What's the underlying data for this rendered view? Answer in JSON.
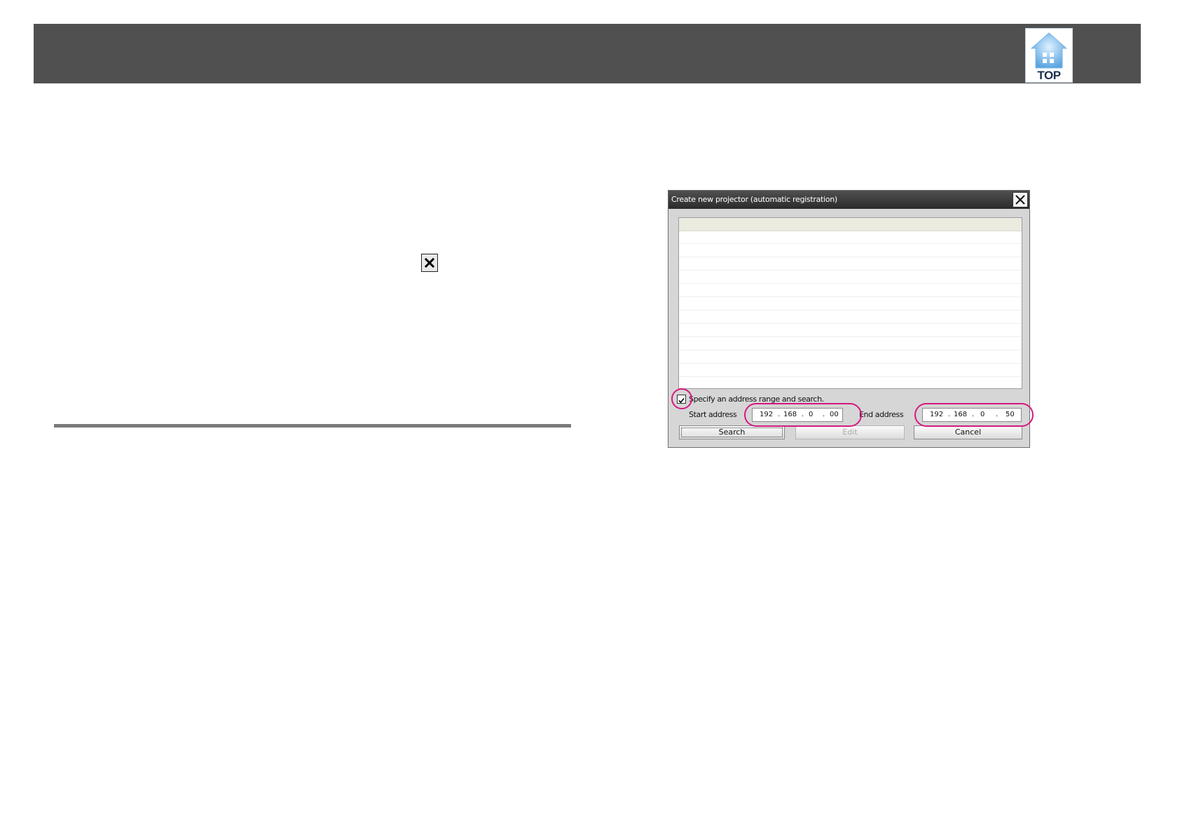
{
  "header": {
    "logo_label": "TOP"
  },
  "dialog": {
    "title": "Create new projector (automatic registration)",
    "specify_range_label": "Specify an address range and search.",
    "specify_range_checked": true,
    "start_address_label": "Start address",
    "end_address_label": "End address",
    "start_address": {
      "o1": "192",
      "o2": "168",
      "o3": "0",
      "o4": "00"
    },
    "end_address": {
      "o1": "192",
      "o2": "168",
      "o3": "0",
      "o4": "50"
    },
    "ip_separator": ".",
    "buttons": {
      "search": "Search",
      "edit": "Edit",
      "cancel": "Cancel"
    }
  },
  "colors": {
    "header_bar": "#505050",
    "highlight": "#d6197f",
    "list_header": "#ecebe0"
  },
  "icons": {
    "logo": "house-top-icon",
    "inline_close": "close-x-icon",
    "dialog_close": "close-x-icon",
    "checkbox": "checkmark-icon"
  }
}
